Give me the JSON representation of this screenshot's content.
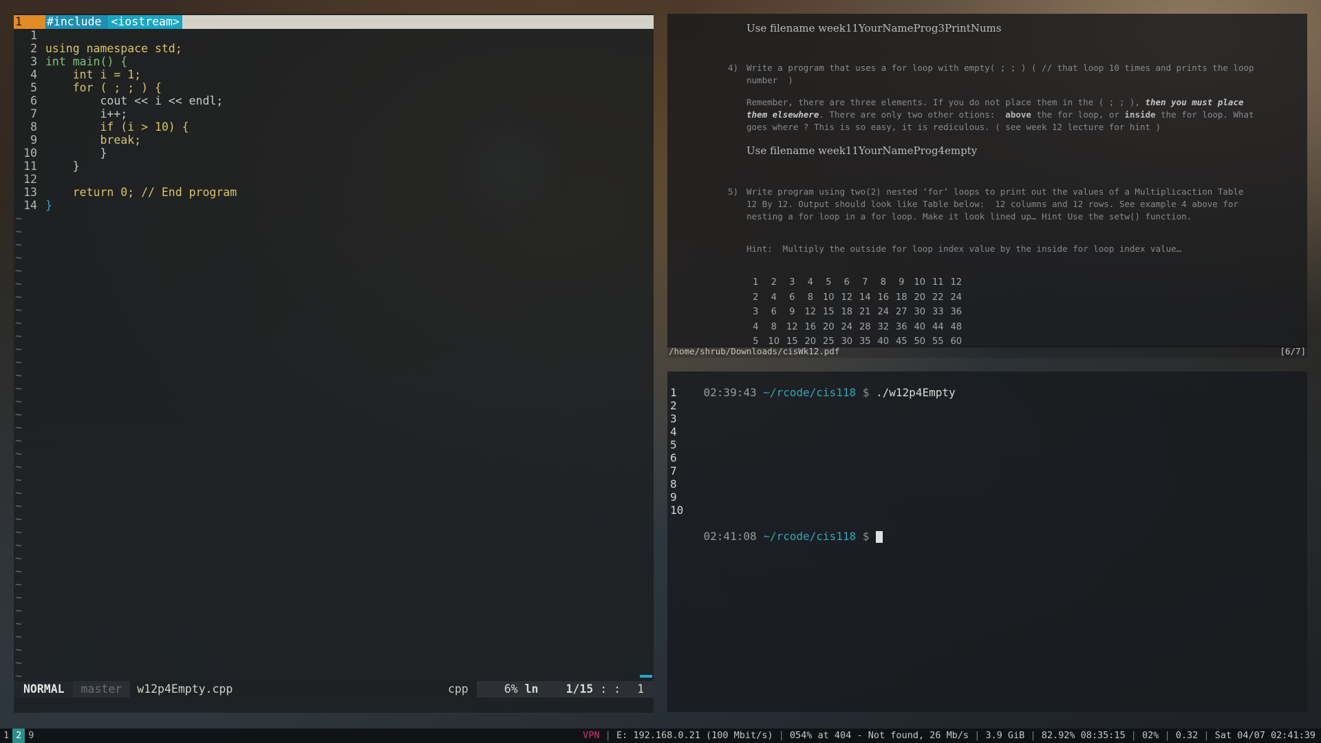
{
  "vim": {
    "tabline": {
      "num": "1",
      "seg1": "#include ",
      "seg2": "<iostream>"
    },
    "code_lines": [
      {
        "n": "1",
        "t": ""
      },
      {
        "n": "2",
        "t": "using namespace std;"
      },
      {
        "n": "3",
        "t": "int main() {"
      },
      {
        "n": "4",
        "t": "    int i = 1;"
      },
      {
        "n": "5",
        "t": "    for ( ; ; ) {"
      },
      {
        "n": "6",
        "t": "        cout << i << endl;"
      },
      {
        "n": "7",
        "t": "        i++;"
      },
      {
        "n": "8",
        "t": "        if (i > 10) {"
      },
      {
        "n": "9",
        "t": "        break;"
      },
      {
        "n": "10",
        "t": "        }"
      },
      {
        "n": "11",
        "t": "    }"
      },
      {
        "n": "12",
        "t": ""
      },
      {
        "n": "13",
        "t": "    return 0; // End program"
      },
      {
        "n": "14",
        "t": "}"
      }
    ],
    "empty_line_marker": "~",
    "status": {
      "mode": "NORMAL",
      "branch": "master",
      "filename": "w12p4Empty.cpp",
      "filetype": "cpp",
      "percent": "6%",
      "ln_label": "ln",
      "position": "1/15",
      "col_sep": ": :",
      "col": "1"
    }
  },
  "pdf": {
    "heading1": "Use filename week11YourNameProg3PrintNums",
    "item4_num": "4)",
    "item4_text": "Write a program that uses a for loop with empty( ; ; ) ( // that loop 10 times and prints the loop number  )",
    "remember_a": "Remember, there are three elements. If you do not place them in the ( ; ; ), ",
    "remember_em": "then you must place them elsewhere",
    "remember_b": ". There are only two other otions:  ",
    "remember_above": "above",
    "remember_c": " the for loop, or ",
    "remember_inside": "inside",
    "remember_d": " the for loop. What goes where ? This is so easy, it is rediculous. ( see week 12 lecture for hint )",
    "heading2": "Use filename week11YourNameProg4empty",
    "item5_num": "5)",
    "item5_text": "Write program using two(2) nested ‘for’ loops to print out the values of a Multiplicaction Table 12 By 12. Output should look like Table below:  12 columns and 12 rows. See example 4 above for nesting a for loop in a for loop. Make it look lined up… Hint Use the setw() function.",
    "hint_text": "Hint:  Multiply the outside for loop index value by the inside for loop index value…",
    "table": [
      [
        "1",
        "2",
        "3",
        "4",
        "5",
        "6",
        "7",
        "8",
        "9",
        "10",
        "11",
        "12"
      ],
      [
        "2",
        "4",
        "6",
        "8",
        "10",
        "12",
        "14",
        "16",
        "18",
        "20",
        "22",
        "24"
      ],
      [
        "3",
        "6",
        "9",
        "12",
        "15",
        "18",
        "21",
        "24",
        "27",
        "30",
        "33",
        "36"
      ],
      [
        "4",
        "8",
        "12",
        "16",
        "20",
        "24",
        "28",
        "32",
        "36",
        "40",
        "44",
        "48"
      ],
      [
        "5",
        "10",
        "15",
        "20",
        "25",
        "30",
        "35",
        "40",
        "45",
        "50",
        "55",
        "60"
      ]
    ],
    "path": "/home/shrub/Downloads/cisWk12.pdf",
    "page": "[6/7]"
  },
  "terminal": {
    "prompt1": {
      "time": "02:39:43",
      "path": "~/rcode/cis118",
      "dollar": "$",
      "cmd": "./w12p4Empty"
    },
    "output": [
      "1",
      "2",
      "3",
      "4",
      "5",
      "6",
      "7",
      "8",
      "9",
      "10"
    ],
    "prompt2": {
      "time": "02:41:08",
      "path": "~/rcode/cis118",
      "dollar": "$"
    }
  },
  "bar": {
    "workspaces": [
      "1",
      "2",
      "9"
    ],
    "active_workspace": "2",
    "vpn": "VPN",
    "ethernet": "E: 192.168.0.21 (100 Mbit/s)",
    "wifi": "054% at 404 - Not found, 26 Mb/s",
    "memory": "3.9 GiB",
    "battery": "82.92% 08:35:15",
    "cpu": "02%",
    "load": "0.32",
    "datetime": "Sat 04/07 02:41:39"
  }
}
